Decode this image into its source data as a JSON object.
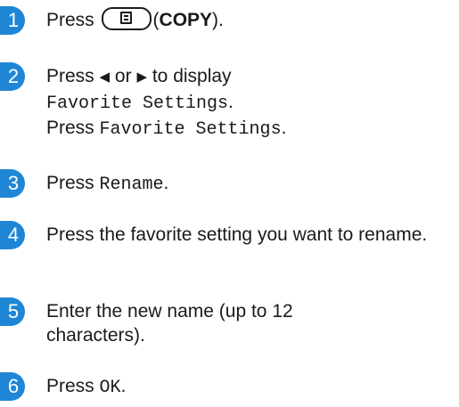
{
  "steps": [
    {
      "number": "1",
      "press": "Press",
      "key_icon": "copy-button-icon",
      "open_paren": "(",
      "copy_label": "COPY",
      "close_paren": ")."
    },
    {
      "number": "2",
      "press": "Press",
      "left_arrow": "◀",
      "or": "or",
      "right_arrow": "▶",
      "to_display": "to display",
      "menu_item": "Favorite Settings",
      "period1": ".",
      "press2": "Press",
      "menu_item2": "Favorite Settings",
      "period2": "."
    },
    {
      "number": "3",
      "press": "Press",
      "button": "Rename",
      "period": "."
    },
    {
      "number": "4",
      "text": "Press the favorite setting you want to rename."
    },
    {
      "number": "5",
      "text": "Enter the new name (up to 12 characters)."
    },
    {
      "number": "6",
      "press": "Press",
      "button": "OK",
      "period": "."
    }
  ]
}
